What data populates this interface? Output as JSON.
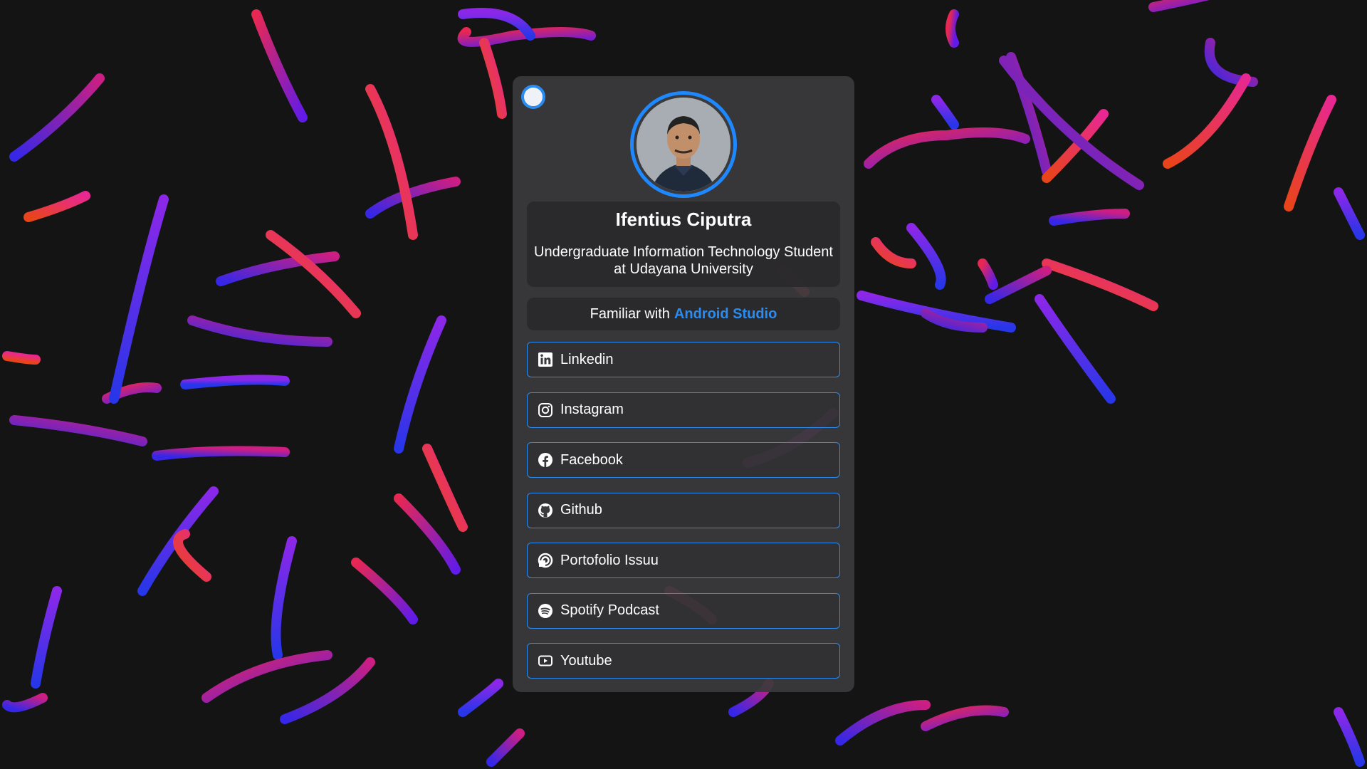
{
  "profile": {
    "name": "Ifentius Ciputra",
    "description": "Undergraduate Information Technology Student at Udayana University"
  },
  "skill": {
    "prefix": "Familiar with",
    "highlight": "Android Studio"
  },
  "links": [
    {
      "label": "Linkedin",
      "icon": "linkedin-icon"
    },
    {
      "label": "Instagram",
      "icon": "instagram-icon"
    },
    {
      "label": "Facebook",
      "icon": "facebook-icon"
    },
    {
      "label": "Github",
      "icon": "github-icon"
    },
    {
      "label": "Portofolio Issuu",
      "icon": "issuu-icon"
    },
    {
      "label": "Spotify Podcast",
      "icon": "spotify-icon"
    },
    {
      "label": "Youtube",
      "icon": "youtube-icon"
    }
  ],
  "colors": {
    "accent": "#2a8cf0",
    "background": "#141415",
    "card": "#3a3a3c"
  }
}
